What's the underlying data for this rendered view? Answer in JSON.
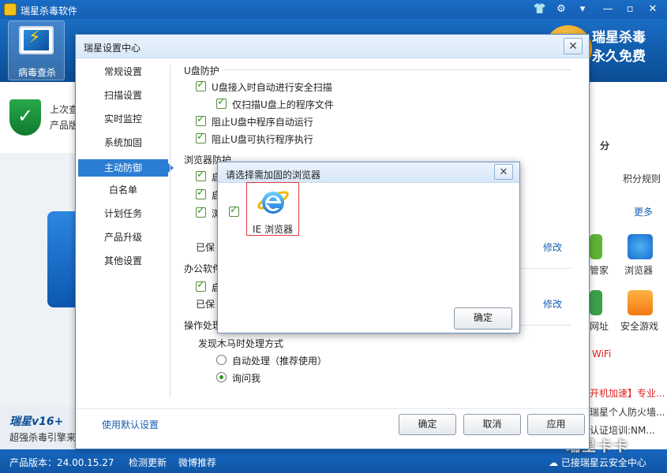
{
  "app": {
    "title": "瑞星杀毒软件",
    "nav_virus_label": "病毒查杀",
    "slogan_line1": "瑞星杀毒",
    "slogan_line2": "永久免费",
    "last_scan_text": "上次查",
    "product_text": "产品版",
    "promo_title": "瑞星v16+",
    "promo_sub": "超强杀毒引擎来",
    "right": {
      "score_text": "分",
      "points_rule": "积分规则",
      "more": "更多",
      "app_housekeeper": "管家",
      "app_browser": "浏览器",
      "app_site": "网址",
      "app_game": "安全游戏",
      "wifi": "WiFi",
      "news1": "开机加速】专业...",
      "news2": "瑞星个人防火墙...",
      "news3": "认证培训:NM..."
    },
    "statusbar": {
      "version": "产品版本：24.00.15.27",
      "check_update": "检测更新",
      "weibo": "微博推荐",
      "cloud": "已接瑞星云安全中心"
    },
    "watermark": "瑞星卡卡"
  },
  "settings": {
    "title": "瑞星设置中心",
    "nav": [
      "常规设置",
      "扫描设置",
      "实时监控",
      "系统加固",
      "主动防御",
      "白名单",
      "计划任务",
      "产品升级",
      "其他设置"
    ],
    "usb": {
      "heading": "U盘防护",
      "opt1": "U盘接入时自动进行安全扫描",
      "opt2": "仅扫描U盘上的程序文件",
      "opt3": "阻止U盘中程序自动运行",
      "opt4": "阻止U盘可执行程序执行"
    },
    "browser": {
      "heading": "浏览器防护",
      "opt1": "启",
      "opt2": "启",
      "opt3": "浏",
      "saved": "已保",
      "modify": "修改"
    },
    "office": {
      "heading": "办公软件",
      "opt1": "启",
      "saved": "已保",
      "modify": "修改"
    },
    "action": {
      "heading": "操作处理",
      "trojan_label": "发现木马时处理方式",
      "auto": "自动处理（推荐使用）",
      "ask": "询问我"
    },
    "default_link": "使用默认设置",
    "buttons": {
      "ok": "确定",
      "cancel": "取消",
      "apply": "应用"
    }
  },
  "popup": {
    "title": "请选择需加固的浏览器",
    "ie_label": "IE 浏览器",
    "ok": "确定"
  }
}
